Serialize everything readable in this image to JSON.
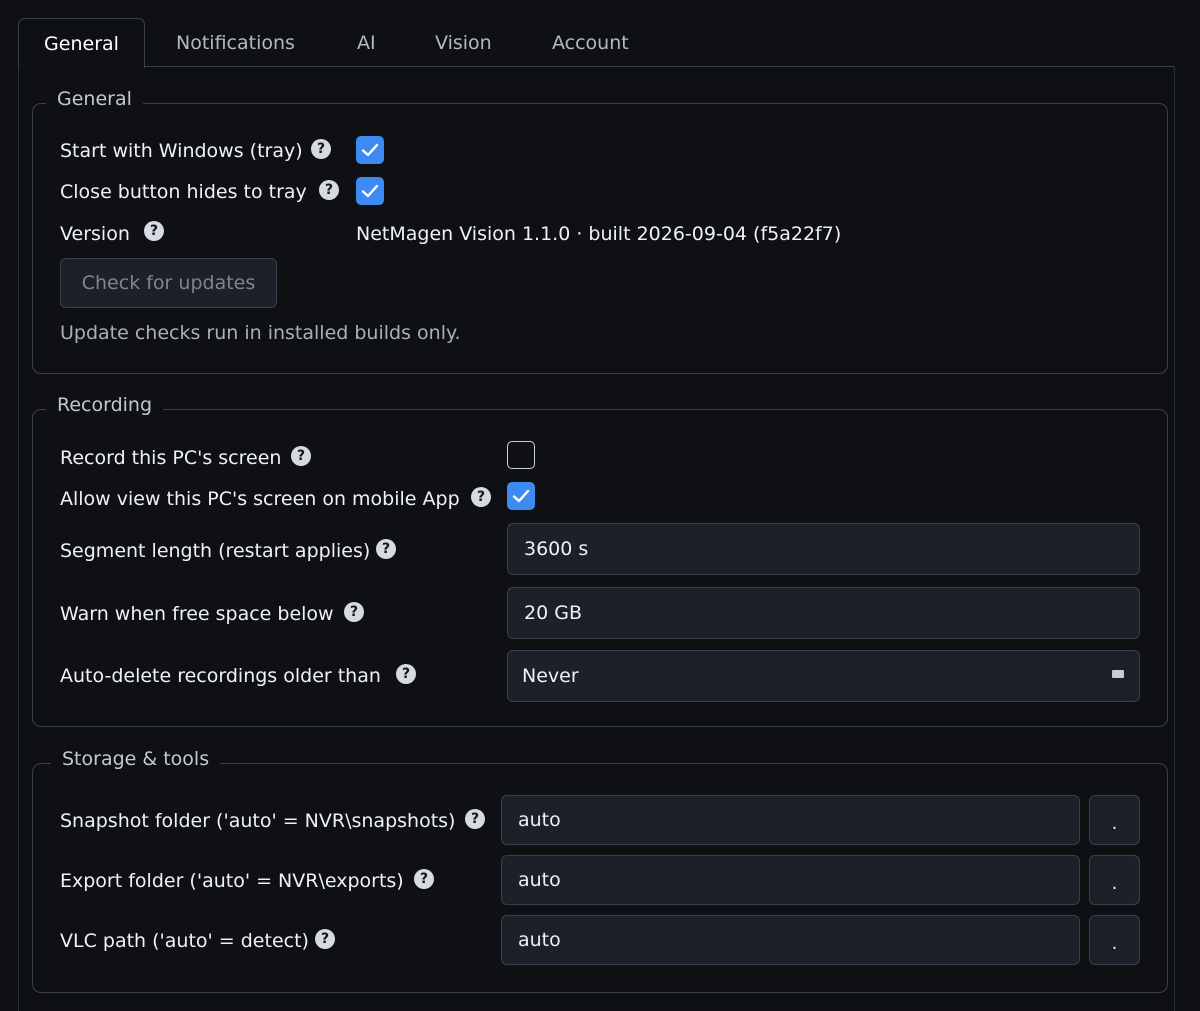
{
  "tabs": [
    "General",
    "Notifications",
    "AI",
    "Vision",
    "Account"
  ],
  "general": {
    "legend": "General",
    "start_with_windows": {
      "label": "Start with Windows (tray)",
      "checked": true
    },
    "close_hides_tray": {
      "label": "Close button hides to tray",
      "checked": true
    },
    "version": {
      "label": "Version",
      "value": "NetMagen Vision 1.1.0 · built 2026-09-04 (f5a22f7)"
    },
    "check_updates_label": "Check for updates",
    "update_note": "Update checks run in installed builds only."
  },
  "recording": {
    "legend": "Recording",
    "record_screen": {
      "label": "Record this PC's screen",
      "checked": false
    },
    "allow_mobile_view": {
      "label": "Allow view this PC's screen on mobile App",
      "checked": true
    },
    "segment_length": {
      "label": "Segment length (restart applies)",
      "value": "3600 s"
    },
    "warn_free_space": {
      "label": "Warn when free space below",
      "value": "20 GB"
    },
    "auto_delete": {
      "label": "Auto-delete recordings older than",
      "value": "Never"
    }
  },
  "storage": {
    "legend": "Storage & tools",
    "snapshot_folder": {
      "label": "Snapshot folder ('auto' = NVR\\snapshots)",
      "value": "auto"
    },
    "export_folder": {
      "label": "Export folder ('auto' = NVR\\exports)",
      "value": "auto"
    },
    "vlc_path": {
      "label": "VLC path ('auto' = detect)",
      "value": "auto"
    },
    "browse_label": "."
  },
  "help_glyph": "?",
  "icons": {
    "help": "help-circle-icon",
    "check": "checkmark-icon",
    "select": "dropdown-arrow-icon"
  },
  "colors": {
    "accent": "#3d8bf2",
    "background": "#0e1014",
    "field": "#1c2129",
    "border": "#3a404a"
  }
}
